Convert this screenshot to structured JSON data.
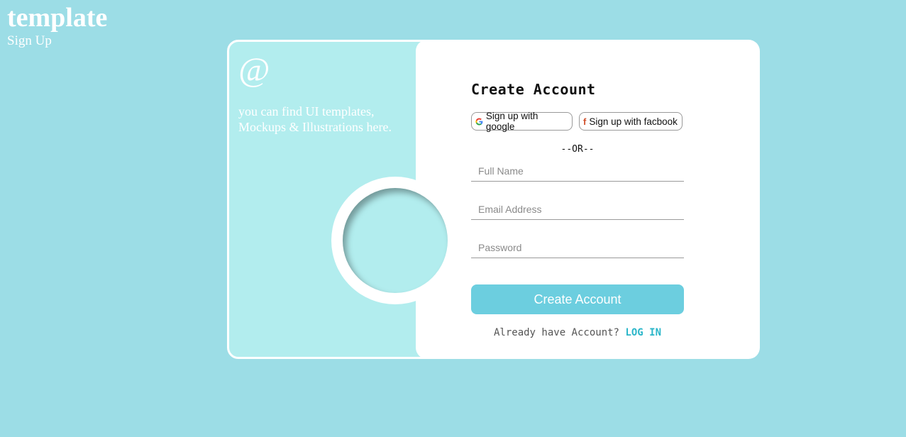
{
  "header": {
    "title": "template",
    "subtitle": "Sign Up"
  },
  "promo": {
    "icon": "at-icon",
    "icon_glyph": "@",
    "tagline": "you can find UI templates, Mockups & Illustrations here."
  },
  "form": {
    "title": "Create Account",
    "google_label": "Sign up with google",
    "facebook_label": "Sign up with facbook",
    "or_text": "--OR--",
    "full_name_placeholder": "Full Name",
    "email_placeholder": "Email Address",
    "password_placeholder": "Password",
    "submit_label": "Create Account",
    "login_prompt": "Already have Account?",
    "login_link": "LOG IN"
  },
  "colors": {
    "background": "#9cdde6",
    "panel_left": "#b2edee",
    "button": "#6ccedf",
    "link": "#2bb6c9"
  }
}
